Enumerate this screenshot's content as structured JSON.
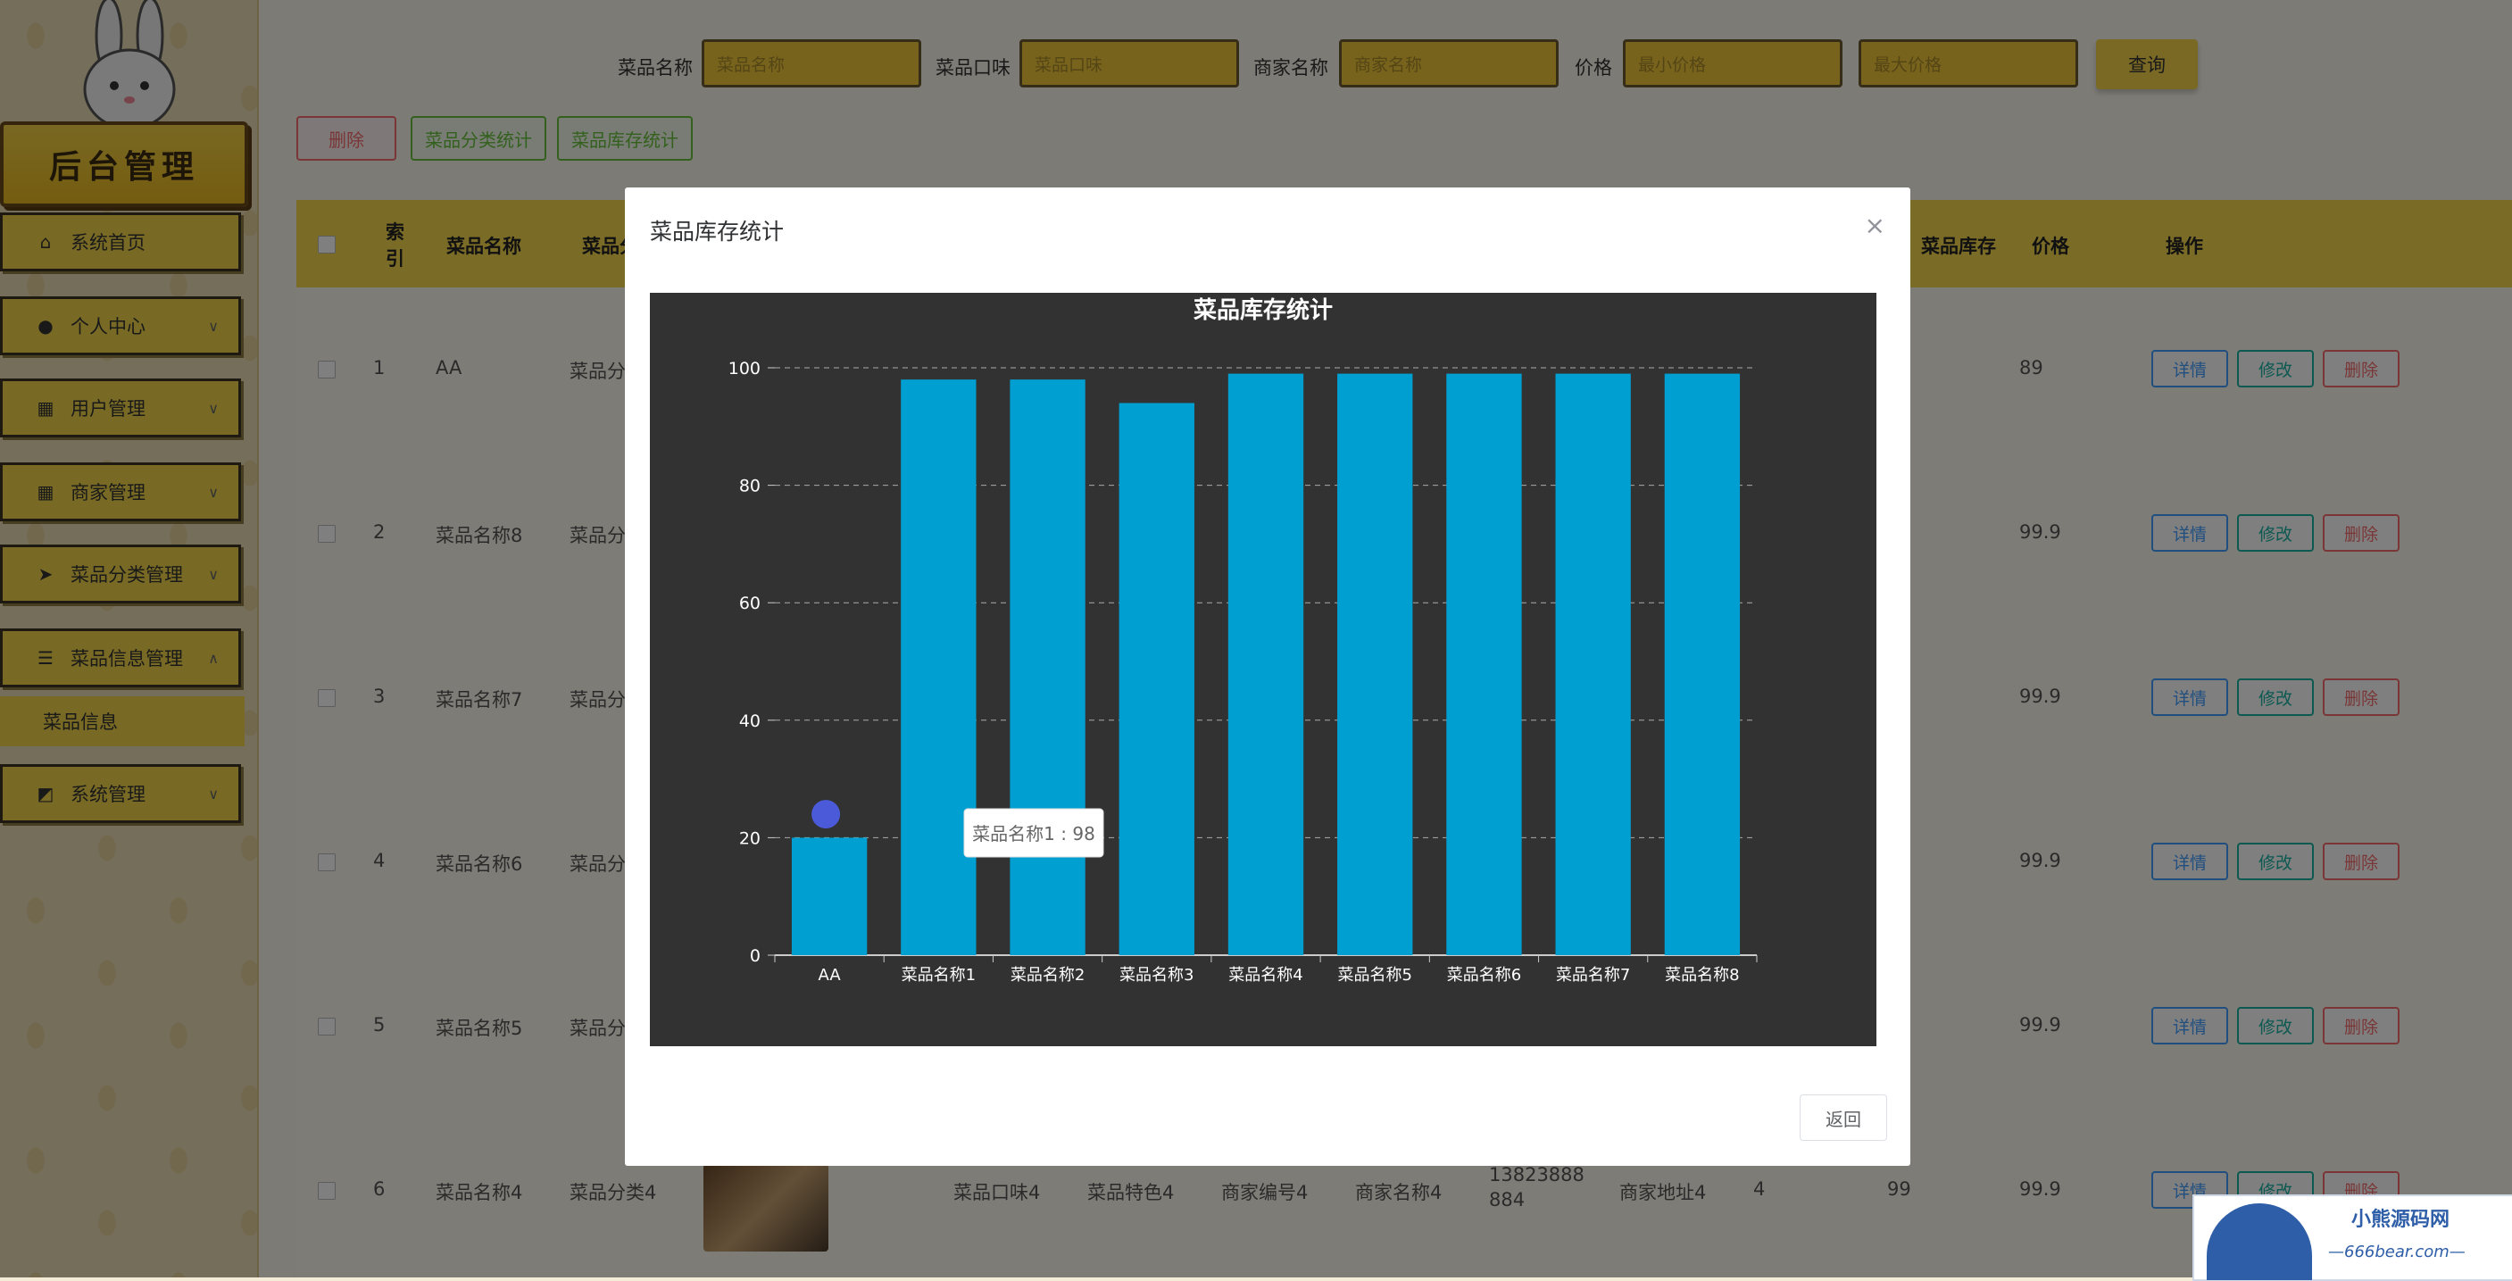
{
  "sidebar": {
    "brand": "后台管理",
    "items": [
      {
        "label": "系统首页",
        "icon": "home-icon"
      },
      {
        "label": "个人中心",
        "icon": "user-icon"
      },
      {
        "label": "用户管理",
        "icon": "grid-icon"
      },
      {
        "label": "商家管理",
        "icon": "grid-icon"
      },
      {
        "label": "菜品分类管理",
        "icon": "send-icon"
      },
      {
        "label": "菜品信息管理",
        "icon": "list-icon"
      },
      {
        "label": "系统管理",
        "icon": "chart-icon"
      }
    ],
    "subitem": "菜品信息"
  },
  "search": {
    "name_label": "菜品名称",
    "name_placeholder": "菜品名称",
    "taste_label": "菜品口味",
    "taste_placeholder": "菜品口味",
    "merchant_label": "商家名称",
    "merchant_placeholder": "商家名称",
    "price_label": "价格",
    "price_min_placeholder": "最小价格",
    "price_max_placeholder": "最大价格",
    "query": "查询"
  },
  "actions": {
    "delete": "删除",
    "category_stats": "菜品分类统计",
    "stock_stats": "菜品库存统计"
  },
  "table": {
    "headers": {
      "index": "索引",
      "name": "菜品名称",
      "category": "菜品分",
      "stock": "菜品库存",
      "price": "价格",
      "ops": "操作"
    },
    "rows": [
      {
        "index": "1",
        "name": "AA",
        "category": "菜品分",
        "price": "89"
      },
      {
        "index": "2",
        "name": "菜品名称8",
        "category": "菜品分",
        "price": "99.9"
      },
      {
        "index": "3",
        "name": "菜品名称7",
        "category": "菜品分",
        "price": "99.9"
      },
      {
        "index": "4",
        "name": "菜品名称6",
        "category": "菜品分",
        "price": "99.9"
      },
      {
        "index": "5",
        "name": "菜品名称5",
        "category": "菜品分",
        "price": "99.9"
      }
    ],
    "last_row": {
      "index": "6",
      "name": "菜品名称4",
      "category": "菜品分类4",
      "taste": "菜品口味4",
      "feature": "菜品特色4",
      "merchant_no": "商家编号4",
      "merchant": "商家名称4",
      "phone": "13823888884",
      "address": "商家地址4",
      "num": "4",
      "stock": "99",
      "price": "99.9"
    },
    "btn_detail": "详情",
    "btn_edit": "修改",
    "btn_delete": "删除"
  },
  "modal": {
    "title": "菜品库存统计",
    "close": "×",
    "return": "返回"
  },
  "chart_data": {
    "type": "bar",
    "title": "菜品库存统计",
    "categories": [
      "AA",
      "菜品名称1",
      "菜品名称2",
      "菜品名称3",
      "菜品名称4",
      "菜品名称5",
      "菜品名称6",
      "菜品名称7",
      "菜品名称8"
    ],
    "values": [
      20,
      98,
      98,
      94,
      99,
      99,
      99,
      99,
      99
    ],
    "ylim": [
      0,
      100
    ],
    "yticks": [
      0,
      20,
      40,
      60,
      80,
      100
    ],
    "grid": true,
    "bar_color": "#009fd1",
    "background": "#323232",
    "tooltip": "菜品名称1 : 98"
  },
  "watermark": {
    "line1": "小熊源码网",
    "line2": "—666bear.com—"
  }
}
